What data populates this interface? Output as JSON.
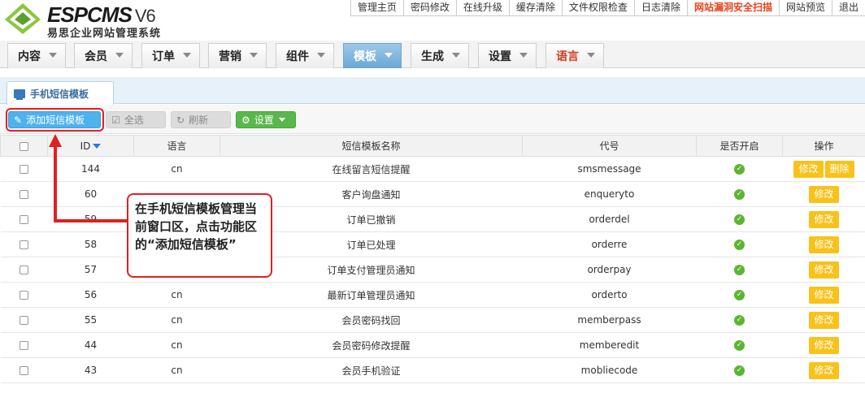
{
  "header": {
    "brand": "ESPCMS",
    "version": "V6",
    "subtitle": "易思企业网站管理系统",
    "links": [
      {
        "label": "管理主页",
        "highlight": false
      },
      {
        "label": "密码修改",
        "highlight": false
      },
      {
        "label": "在线升级",
        "highlight": false
      },
      {
        "label": "缓存清除",
        "highlight": false
      },
      {
        "label": "文件权限检查",
        "highlight": false
      },
      {
        "label": "日志清除",
        "highlight": false
      },
      {
        "label": "网站漏洞安全扫描",
        "highlight": true
      },
      {
        "label": "网站预览",
        "highlight": false
      },
      {
        "label": "退出",
        "highlight": false
      }
    ]
  },
  "nav": {
    "tabs": [
      {
        "label": "内容"
      },
      {
        "label": "会员"
      },
      {
        "label": "订单"
      },
      {
        "label": "营销"
      },
      {
        "label": "组件"
      },
      {
        "label": "模板",
        "active": true
      },
      {
        "label": "生成"
      },
      {
        "label": "设置"
      },
      {
        "label": "语言"
      }
    ]
  },
  "panel": {
    "tab_label": "手机短信模板"
  },
  "toolbar": {
    "add_label": "添加短信模板",
    "select_all_label": "全选",
    "refresh_label": "刷新",
    "settings_label": "设置"
  },
  "table": {
    "headers": [
      "ID",
      "语言",
      "短信模板名称",
      "代号",
      "是否开启",
      "操作"
    ],
    "edit_label": "修改",
    "delete_label": "删除",
    "rows": [
      {
        "id": "144",
        "lang": "cn",
        "name": "在线留言短信提醒",
        "code": "smsmessage"
      },
      {
        "id": "60",
        "lang": "",
        "name": "客户询盘通知",
        "code": "enqueryto"
      },
      {
        "id": "59",
        "lang": "",
        "name": "订单已撤销",
        "code": "orderdel"
      },
      {
        "id": "58",
        "lang": "",
        "name": "订单已处理",
        "code": "orderre"
      },
      {
        "id": "57",
        "lang": "",
        "name": "订单支付管理员通知",
        "code": "orderpay"
      },
      {
        "id": "56",
        "lang": "cn",
        "name": "最新订单管理员通知",
        "code": "orderto"
      },
      {
        "id": "55",
        "lang": "cn",
        "name": "会员密码找回",
        "code": "memberpass"
      },
      {
        "id": "44",
        "lang": "cn",
        "name": "会员密码修改提醒",
        "code": "memberedit"
      },
      {
        "id": "43",
        "lang": "cn",
        "name": "会员手机验证",
        "code": "mobliecode"
      }
    ]
  },
  "annotation": {
    "text": "在手机短信模板管理当前窗口区，点击功能区的“添加短信模板”"
  },
  "colors": {
    "accent_blue": "#4eb2ec",
    "nav_active": "#6aa7d6",
    "ok_green": "#5cb531",
    "button_yellow": "#f8c21a",
    "annotation_red": "#e02020",
    "highlight_link": "#e8431f"
  }
}
